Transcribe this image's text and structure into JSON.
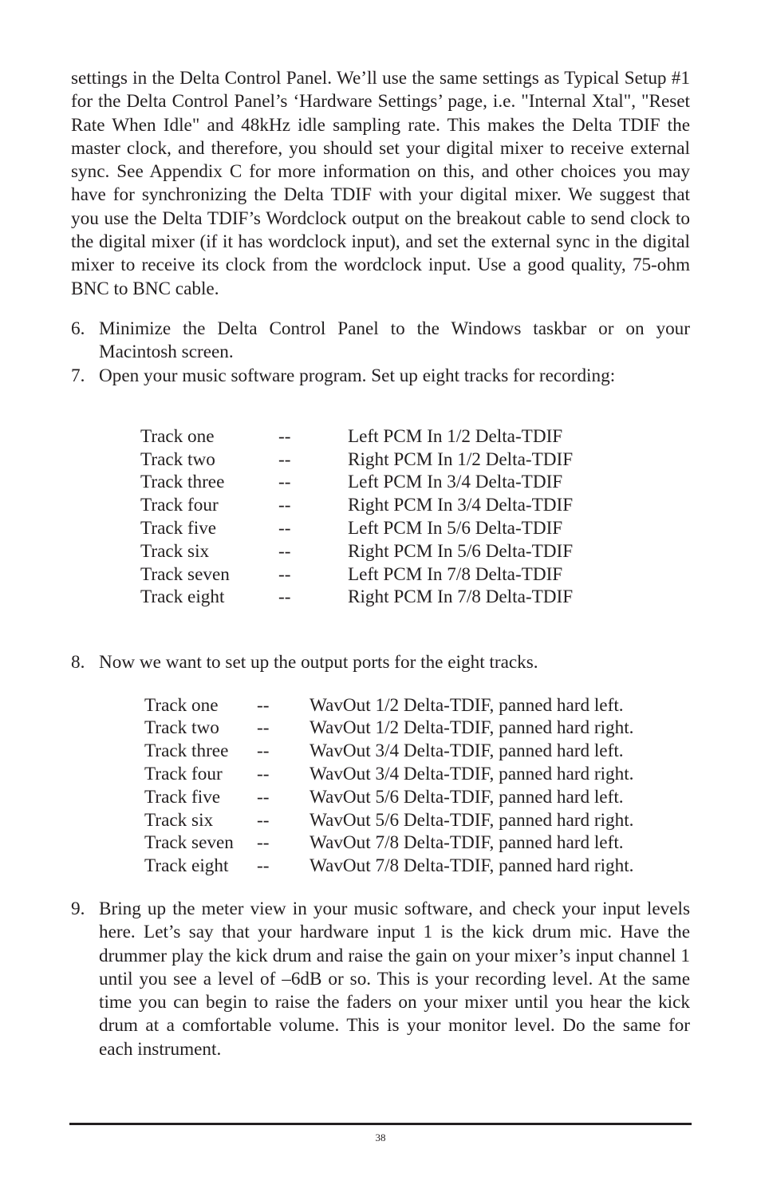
{
  "intro_paragraph": "settings in the Delta Control Panel. We’ll use the same settings as Typical Setup #1 for the Delta Control Panel’s ‘Hardware Settings’ page, i.e. \"Internal Xtal\", \"Reset Rate When Idle\" and 48kHz idle sampling rate. This makes the Delta TDIF the master clock, and therefore, you should set your digital mixer to receive external sync. See Appendix C for more information on this, and other choices you may have for synchronizing the Delta TDIF with your digital mixer. We suggest that you use the Delta TDIF’s Wordclock output on the breakout cable to send clock to the digital mixer (if it has wordclock input), and set the external sync in the digital mixer to receive its clock from the wordclock input.  Use a good quality, 75-ohm BNC to BNC cable.",
  "steps": [
    {
      "number": "6.",
      "text": "Minimize the Delta Control Panel to the Windows taskbar or on your Macintosh screen."
    },
    {
      "number": "7.",
      "text": "Open your music software program.  Set up eight tracks for recording:"
    },
    {
      "number": "8.",
      "text": "Now we want to set up the output ports for the eight tracks."
    },
    {
      "number": "9.",
      "text": "Bring up the meter view in your music software, and check your input levels here. Let’s say that your hardware input 1 is the kick drum mic. Have the drummer play the kick drum and raise the gain on your mixer’s input channel 1 until you see a level of –6dB or so. This is your recording level. At the same time you can begin to raise the faders on your mixer until you hear the kick drum at a comfortable volume. This is your monitor level. Do the same for each instrument."
    }
  ],
  "input_table": [
    {
      "track": "Track one",
      "sep": "--",
      "port": "Left PCM In 1/2 Delta-TDIF"
    },
    {
      "track": "Track two",
      "sep": "--",
      "port": "Right PCM In 1/2 Delta-TDIF"
    },
    {
      "track": "Track three",
      "sep": "--",
      "port": "Left PCM In 3/4 Delta-TDIF"
    },
    {
      "track": "Track four",
      "sep": "--",
      "port": "Right PCM In 3/4 Delta-TDIF"
    },
    {
      "track": "Track five",
      "sep": "--",
      "port": "Left PCM In 5/6 Delta-TDIF"
    },
    {
      "track": "Track six",
      "sep": "--",
      "port": "Right PCM In 5/6 Delta-TDIF"
    },
    {
      "track": "Track seven",
      "sep": "--",
      "port": "Left PCM In 7/8 Delta-TDIF"
    },
    {
      "track": "Track eight",
      "sep": "--",
      "port": "Right PCM In 7/8 Delta-TDIF"
    }
  ],
  "output_table": [
    {
      "track": "Track one",
      "sep": "--",
      "port": "WavOut 1/2 Delta-TDIF, panned hard left."
    },
    {
      "track": "Track two",
      "sep": "--",
      "port": "WavOut 1/2 Delta-TDIF, panned hard right."
    },
    {
      "track": "Track three",
      "sep": "--",
      "port": "WavOut 3/4 Delta-TDIF, panned hard left."
    },
    {
      "track": "Track four",
      "sep": "--",
      "port": "WavOut 3/4 Delta-TDIF, panned hard right."
    },
    {
      "track": "Track five",
      "sep": "--",
      "port": "WavOut 5/6 Delta-TDIF, panned hard left."
    },
    {
      "track": "Track six",
      "sep": "--",
      "port": "WavOut 5/6 Delta-TDIF, panned hard right."
    },
    {
      "track": "Track seven",
      "sep": "--",
      "port": "WavOut 7/8 Delta-TDIF, panned hard left."
    },
    {
      "track": "Track eight",
      "sep": "--",
      "port": "WavOut 7/8 Delta-TDIF, panned hard right."
    }
  ],
  "footer": {
    "page_number": "38"
  }
}
